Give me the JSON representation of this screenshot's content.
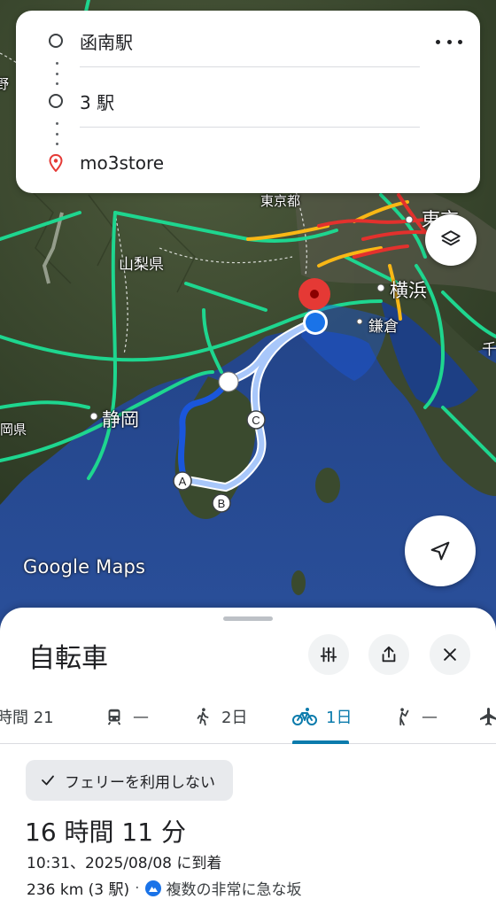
{
  "route": {
    "stops": [
      {
        "label": "函南駅",
        "type": "origin"
      },
      {
        "label": "3 駅",
        "type": "waypoint"
      },
      {
        "label": "mo3store",
        "type": "destination"
      }
    ],
    "more_icon": "more-horiz-icon"
  },
  "map": {
    "watermark": "Google Maps",
    "labels": {
      "tokyo_to": "東京都",
      "yamanashi": "山梨県",
      "yokohama": "横浜",
      "kamakura": "鎌倉",
      "shizuoka": "静岡",
      "shizuoka_ken": "岡県",
      "tokyo": "東京",
      "chiba_partial": "千",
      "left_partial": "長野"
    },
    "waypoints": [
      "A",
      "B",
      "C"
    ],
    "colors": {
      "route_primary": "#1a56db",
      "route_alt": "#a8c7fa",
      "traffic_green": "#1ed68f",
      "traffic_yellow": "#f9b715",
      "traffic_red": "#e3312d",
      "destination_pin": "#e53935",
      "origin_dot": "#1a73e8"
    }
  },
  "sheet": {
    "title": "自転車",
    "tabs": [
      {
        "icon": "",
        "label": "時間 21"
      },
      {
        "icon": "train-icon",
        "label": "—"
      },
      {
        "icon": "walk-icon",
        "label": "2日"
      },
      {
        "icon": "bicycle-icon",
        "label": "1日",
        "active": true
      },
      {
        "icon": "hail-icon",
        "label": "—"
      },
      {
        "icon": "flight-icon",
        "label": ""
      }
    ],
    "filter_chip": "フェリーを利用しない",
    "duration": "16 時間 11 分",
    "arrival": "10:31、2025/08/08 に到着",
    "distance": "236 km (3 駅)",
    "separator": "·",
    "warning": "複数の非常に急な坂",
    "accent": "#0b7bac"
  }
}
